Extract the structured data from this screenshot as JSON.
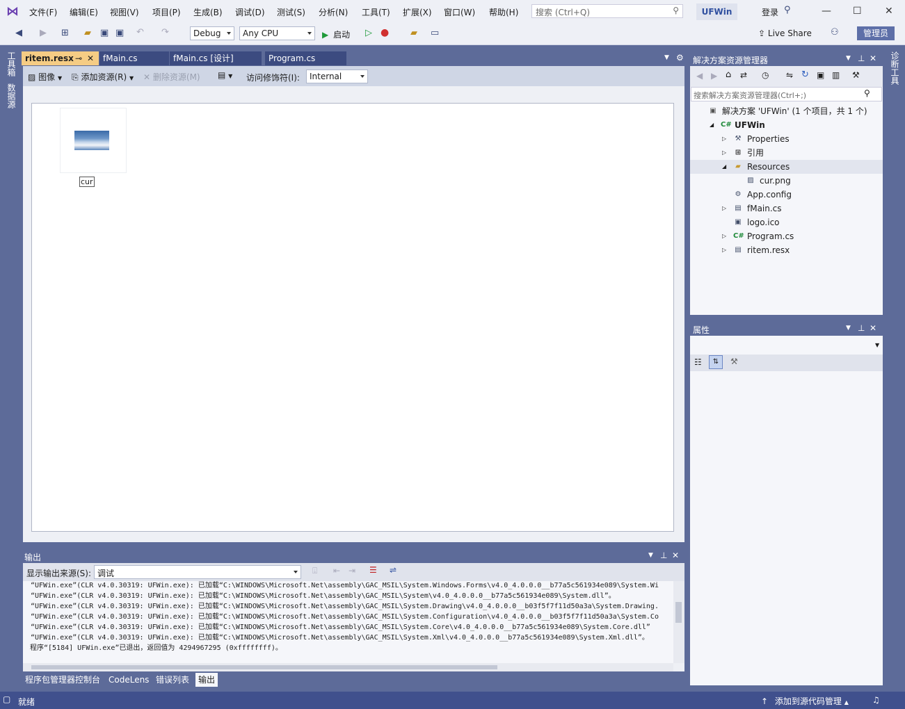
{
  "menu": [
    "文件(F)",
    "编辑(E)",
    "视图(V)",
    "项目(P)",
    "生成(B)",
    "调试(D)",
    "测试(S)",
    "分析(N)",
    "工具(T)",
    "扩展(X)",
    "窗口(W)",
    "帮助(H)"
  ],
  "search_placeholder": "搜索 (Ctrl+Q)",
  "project_name": "UFWin",
  "login": "登录",
  "toolbar": {
    "config": "Debug",
    "platform": "Any CPU",
    "start": "启动",
    "live_share": "Live Share",
    "admin": "管理员"
  },
  "left_strip": [
    "工具箱",
    "数据源"
  ],
  "right_strip": "诊断工具",
  "doc_tabs": [
    "ritem.resx",
    "fMain.cs",
    "fMain.cs [设计]",
    "Program.cs"
  ],
  "resx_toolbar": {
    "image": "图像",
    "add_resource": "添加资源(R)",
    "remove_resource": "删除资源(M)",
    "access_modifier_label": "访问修饰符(I):",
    "access_modifier_value": "Internal"
  },
  "resource_item": {
    "name": "cur"
  },
  "solution_explorer": {
    "title": "解决方案资源管理器",
    "search_placeholder": "搜索解决方案资源管理器(Ctrl+;)",
    "tree": [
      {
        "label": "解决方案 'UFWin' (1 个项目，共 1 个)",
        "level": 0,
        "icon": "solution-icon",
        "expander": ""
      },
      {
        "label": "UFWin",
        "level": 1,
        "icon": "csharp-project-icon",
        "expander": "open",
        "bold": true
      },
      {
        "label": "Properties",
        "level": 2,
        "icon": "wrench-icon",
        "expander": "closed"
      },
      {
        "label": "引用",
        "level": 2,
        "icon": "references-icon",
        "expander": "closed"
      },
      {
        "label": "Resources",
        "level": 2,
        "icon": "folder-icon",
        "expander": "open",
        "selected": true
      },
      {
        "label": "cur.png",
        "level": 3,
        "icon": "image-file-icon",
        "expander": ""
      },
      {
        "label": "App.config",
        "level": 2,
        "icon": "config-file-icon",
        "expander": ""
      },
      {
        "label": "fMain.cs",
        "level": 2,
        "icon": "form-icon",
        "expander": "closed"
      },
      {
        "label": "logo.ico",
        "level": 2,
        "icon": "ico-file-icon",
        "expander": ""
      },
      {
        "label": "Program.cs",
        "level": 2,
        "icon": "csharp-file-icon",
        "expander": "closed"
      },
      {
        "label": "ritem.resx",
        "level": 2,
        "icon": "resx-file-icon",
        "expander": "closed"
      }
    ]
  },
  "properties": {
    "title": "属性"
  },
  "output": {
    "title": "输出",
    "source_label": "显示输出来源(S):",
    "source_value": "调试",
    "lines": [
      "“UFWin.exe”(CLR v4.0.30319: UFWin.exe): 已加载“C:\\WINDOWS\\Microsoft.Net\\assembly\\GAC_MSIL\\System.Windows.Forms\\v4.0_4.0.0.0__b77a5c561934e089\\System.Wi",
      "“UFWin.exe”(CLR v4.0.30319: UFWin.exe): 已加载“C:\\WINDOWS\\Microsoft.Net\\assembly\\GAC_MSIL\\System\\v4.0_4.0.0.0__b77a5c561934e089\\System.dll”。",
      "“UFWin.exe”(CLR v4.0.30319: UFWin.exe): 已加载“C:\\WINDOWS\\Microsoft.Net\\assembly\\GAC_MSIL\\System.Drawing\\v4.0_4.0.0.0__b03f5f7f11d50a3a\\System.Drawing.",
      "“UFWin.exe”(CLR v4.0.30319: UFWin.exe): 已加载“C:\\WINDOWS\\Microsoft.Net\\assembly\\GAC_MSIL\\System.Configuration\\v4.0_4.0.0.0__b03f5f7f11d50a3a\\System.Co",
      "“UFWin.exe”(CLR v4.0.30319: UFWin.exe): 已加载“C:\\WINDOWS\\Microsoft.Net\\assembly\\GAC_MSIL\\System.Core\\v4.0_4.0.0.0__b77a5c561934e089\\System.Core.dll”",
      "“UFWin.exe”(CLR v4.0.30319: UFWin.exe): 已加载“C:\\WINDOWS\\Microsoft.Net\\assembly\\GAC_MSIL\\System.Xml\\v4.0_4.0.0.0__b77a5c561934e089\\System.Xml.dll”。",
      "程序“[5184] UFWin.exe”已退出，返回值为 4294967295 (0xffffffff)。"
    ]
  },
  "bottom_tabs": [
    "程序包管理器控制台",
    "CodeLens",
    "错误列表",
    "输出"
  ],
  "status": {
    "ready": "就绪",
    "source_control": "添加到源代码管理"
  },
  "colors": {
    "accent": "#5d6b99",
    "active_tab": "#f5cc84",
    "statusbar": "#40508d"
  }
}
